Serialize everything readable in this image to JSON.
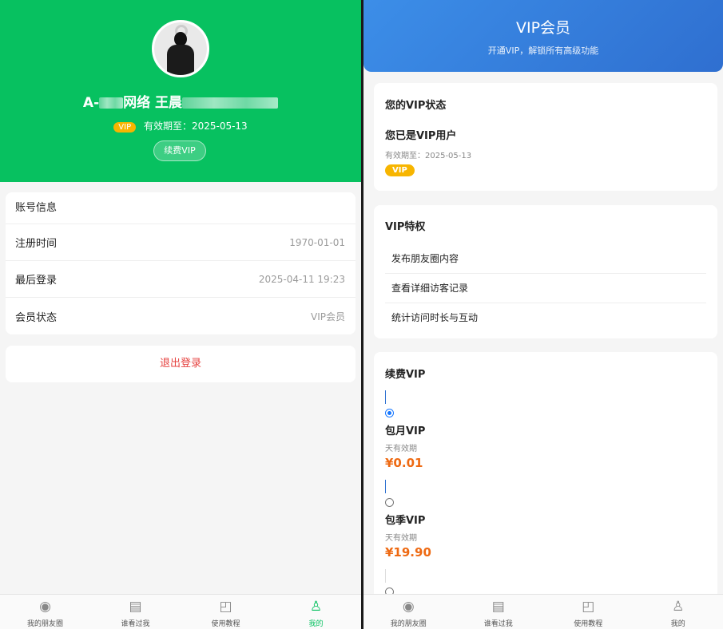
{
  "left": {
    "header": {
      "name_prefix": "A-",
      "name_middle": "网络 王晨",
      "vip_badge": "VIP",
      "expiry_text": "有效期至：2025-05-13",
      "renew_button": "续费VIP"
    },
    "account": {
      "title": "账号信息",
      "rows": [
        {
          "label": "注册时间",
          "value": "1970-01-01"
        },
        {
          "label": "最后登录",
          "value": "2025-04-11 19:23"
        },
        {
          "label": "会员状态",
          "value": "VIP会员"
        }
      ]
    },
    "logout_label": "退出登录",
    "tabs": [
      {
        "label": "我的朋友圈",
        "icon": "aperture-icon"
      },
      {
        "label": "谁看过我",
        "icon": "document-view-icon"
      },
      {
        "label": "使用教程",
        "icon": "bookmark-icon"
      },
      {
        "label": "我的",
        "icon": "user-icon"
      }
    ]
  },
  "right": {
    "header": {
      "title": "VIP会员",
      "subtitle": "开通VIP，解锁所有高级功能"
    },
    "status": {
      "title": "您的VIP状态",
      "user_text": "您已是VIP用户",
      "expiry_text": "有效期至：2025-05-13",
      "badge": "VIP"
    },
    "privileges": {
      "title": "VIP特权",
      "items": [
        "发布朋友圈内容",
        "查看详细访客记录",
        "统计访问时长与互动"
      ]
    },
    "renew": {
      "title": "续费VIP",
      "plans": [
        {
          "name": "包月VIP",
          "validity": "天有效期",
          "price": "¥0.01",
          "selected": true
        },
        {
          "name": "包季VIP",
          "validity": "天有效期",
          "price": "¥19.90",
          "selected": false
        }
      ]
    },
    "tabs": [
      {
        "label": "我的朋友圈"
      },
      {
        "label": "谁看过我"
      },
      {
        "label": "使用教程"
      },
      {
        "label": "我的"
      }
    ]
  },
  "colors": {
    "brand_green": "#07c160",
    "vip_blue": "#2f6fd0",
    "vip_gold": "#f7b500",
    "price_orange": "#ee6a13",
    "logout_red": "#e64340"
  }
}
